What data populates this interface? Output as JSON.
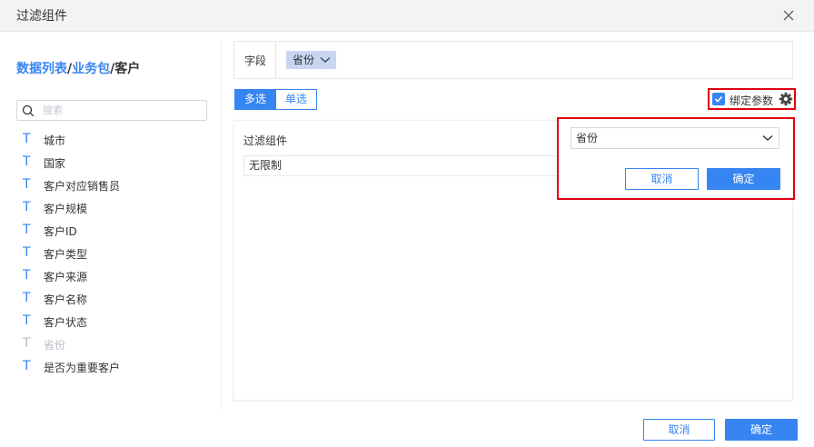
{
  "dialog": {
    "title": "过滤组件",
    "close_icon": "close-icon"
  },
  "left": {
    "breadcrumb": {
      "part1": "数据列表",
      "sep1": "/",
      "part2": "业务包",
      "sep2": "/",
      "part3": "客户"
    },
    "search": {
      "placeholder": "搜索",
      "value": "",
      "icon": "search-icon"
    },
    "fields": [
      {
        "type_icon": "T",
        "label": "城市",
        "disabled": false
      },
      {
        "type_icon": "T",
        "label": "国家",
        "disabled": false
      },
      {
        "type_icon": "T",
        "label": "客户对应销售员",
        "disabled": false
      },
      {
        "type_icon": "T",
        "label": "客户规模",
        "disabled": false
      },
      {
        "type_icon": "T",
        "label": "客户ID",
        "disabled": false
      },
      {
        "type_icon": "T",
        "label": "客户类型",
        "disabled": false
      },
      {
        "type_icon": "T",
        "label": "客户来源",
        "disabled": false
      },
      {
        "type_icon": "T",
        "label": "客户名称",
        "disabled": false
      },
      {
        "type_icon": "T",
        "label": "客户状态",
        "disabled": false
      },
      {
        "type_icon": "T",
        "label": "省份",
        "disabled": true
      },
      {
        "type_icon": "T",
        "label": "是否为重要客户",
        "disabled": false
      }
    ]
  },
  "main": {
    "field_row": {
      "label": "字段",
      "tag": "省份"
    },
    "mode": {
      "multi": "多选",
      "single": "单选",
      "selected": "多选"
    },
    "bind": {
      "label": "绑定参数",
      "checked": true,
      "gear_icon": "gear-icon"
    },
    "panel": {
      "title": "过滤组件",
      "value": "无限制"
    },
    "popup": {
      "select_value": "省份",
      "cancel": "取消",
      "confirm": "确定"
    }
  },
  "footer": {
    "cancel": "取消",
    "confirm": "确定"
  },
  "colors": {
    "accent": "#3685f2",
    "highlight": "#e0000f",
    "tag_bg": "#c8d6f1",
    "titlebar_bg": "#f2f3f5"
  }
}
